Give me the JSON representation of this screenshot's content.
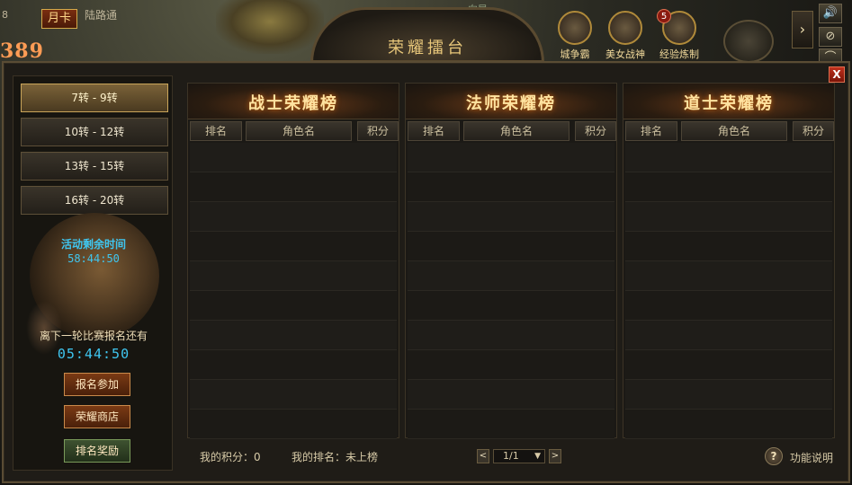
{
  "top": {
    "level_num": "8",
    "month_card": "月卡",
    "link": "陆路通",
    "power": "389",
    "tag": "向导",
    "arena_title": "荣耀擂台",
    "events": [
      {
        "label": "城争霸",
        "icon": "siege-icon"
      },
      {
        "label": "美女战神",
        "icon": "goddess-icon",
        "badge": "5"
      },
      {
        "label": "经验炼制",
        "icon": "exp-refine-icon"
      }
    ],
    "expand_arrow": "›",
    "side_icons": [
      "🔊",
      "⊘",
      "⌒"
    ]
  },
  "panel": {
    "close": "X",
    "tiers": [
      "7转 - 9转",
      "10转 - 12转",
      "13转 - 15转",
      "16转 - 20转"
    ],
    "active_tier": 0,
    "activity_label": "活动剩余时间",
    "activity_time": "58:44:50",
    "next_label": "离下一轮比赛报名还有",
    "next_time": "05:44:50",
    "buttons": {
      "signup": "报名参加",
      "shop": "荣耀商店",
      "rewards": "排名奖励"
    },
    "boards": [
      {
        "title": "战士荣耀榜",
        "cols": [
          "排名",
          "角色名",
          "积分"
        ]
      },
      {
        "title": "法师荣耀榜",
        "cols": [
          "排名",
          "角色名",
          "积分"
        ]
      },
      {
        "title": "道士荣耀榜",
        "cols": [
          "排名",
          "角色名",
          "积分"
        ]
      }
    ],
    "my_score": "我的积分：0",
    "my_rank": "我的排名：未上榜",
    "pager": {
      "prev": "<",
      "page": "1/1",
      "next": ">"
    },
    "help": "功能说明"
  }
}
